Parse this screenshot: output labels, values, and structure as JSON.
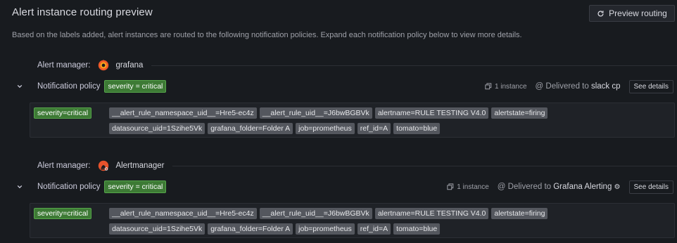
{
  "header": {
    "title": "Alert instance routing preview",
    "preview_button": "Preview routing",
    "description": "Based on the labels added, alert instances are routed to the following notification policies. Expand each notification policy below to view more details."
  },
  "groups": [
    {
      "am_label": "Alert manager:",
      "am_name": "grafana",
      "am_icon": "grafana-logo-icon",
      "policy_label": "Notification policy",
      "policy_matcher": "severity = critical",
      "instances": "1 instance",
      "delivered_prefix": "@ Delivered to",
      "contact_point": "slack cp",
      "see_details": "See details",
      "severity_tag": "severity=critical",
      "labels": [
        "__alert_rule_namespace_uid__=Hre5-ec4z",
        "__alert_rule_uid__=J6bwBGBVk",
        "alertname=RULE TESTING V4.0",
        "alertstate=firing",
        "datasource_uid=1Szihe5Vk",
        "grafana_folder=Folder A",
        "job=prometheus",
        "ref_id=A",
        "tomato=blue"
      ]
    },
    {
      "am_label": "Alert manager:",
      "am_name": "Alertmanager",
      "am_icon": "alertmanager-logo-icon",
      "policy_label": "Notification policy",
      "policy_matcher": "severity = critical",
      "instances": "1 instance",
      "delivered_prefix": "@ Delivered to",
      "contact_point": "Grafana Alerting",
      "see_details": "See details",
      "severity_tag": "severity=critical",
      "labels": [
        "__alert_rule_namespace_uid__=Hre5-ec4z",
        "__alert_rule_uid__=J6bwBGBVk",
        "alertname=RULE TESTING V4.0",
        "alertstate=firing",
        "datasource_uid=1Szihe5Vk",
        "grafana_folder=Folder A",
        "job=prometheus",
        "ref_id=A",
        "tomato=blue"
      ]
    }
  ],
  "colors": {
    "background": "#181b1f",
    "matcher_green": "#3d7a35",
    "label_gray": "#54575e"
  }
}
